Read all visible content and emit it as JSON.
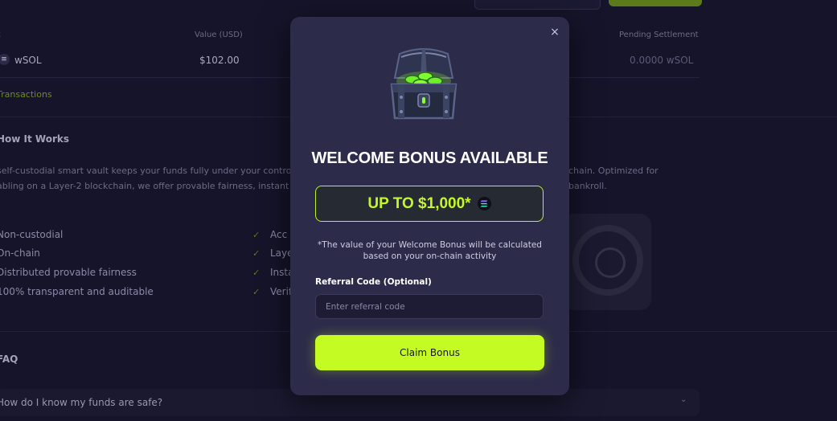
{
  "background": {
    "table": {
      "headers": [
        "sset",
        "Value (USD)",
        "Pending Settlement"
      ],
      "row": {
        "asset": "wSOL",
        "value": "$102.00",
        "pending": "0.0000 wSOL"
      },
      "transactions_link": "Transactions"
    },
    "how_it_works": {
      "heading": "How It Works",
      "para_left": [
        "self-custodial smart vault keeps your funds fully under your contro",
        "abling on a Layer-2 blockchain, we offer provable fairness, instant a"
      ],
      "para_right": [
        "chain. Optimized for",
        "bankroll."
      ],
      "features_left": [
        "Non-custodial",
        "On-chain",
        "Distributed provable fairness",
        "100% transparent and auditable"
      ],
      "features_right": [
        "Acc",
        "Laye",
        "Insta",
        "Verif"
      ]
    },
    "faq": {
      "heading": "FAQ",
      "question": "How do I know my funds are safe?"
    }
  },
  "modal": {
    "title": "WELCOME BONUS AVAILABLE",
    "bonus": "UP TO $1,000*",
    "note": "*The value of your Welcome Bonus will be calculated based on your on-chain activity",
    "referral_label": "Referral Code (Optional)",
    "referral_placeholder": "Enter referral code",
    "referral_value": "",
    "claim_label": "Claim Bonus",
    "close_glyph": "×",
    "icons": {
      "close": "close-icon",
      "chest": "treasure-chest-icon",
      "token": "solana-icon"
    }
  },
  "colors": {
    "accent": "#c4fb22",
    "modal_bg": "#2d2b4a",
    "page_bg": "#15142a"
  }
}
